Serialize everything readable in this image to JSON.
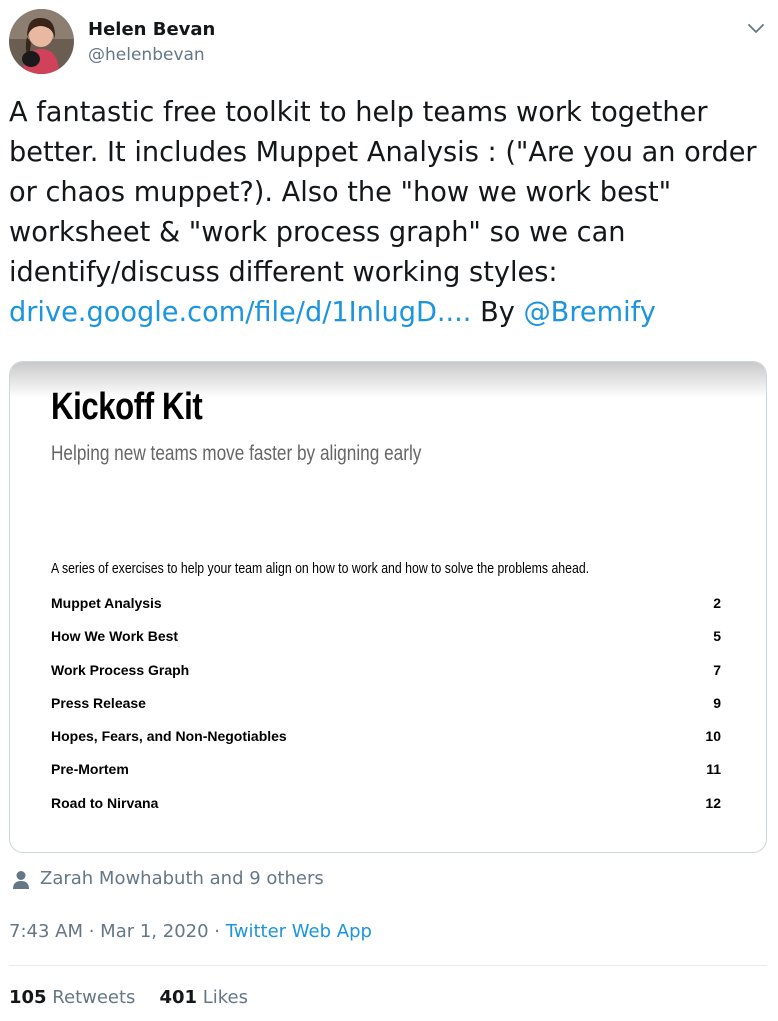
{
  "author": {
    "name": "Helen Bevan",
    "handle": "@helenbevan"
  },
  "tweet": {
    "lines": [
      "A fantastic free toolkit to help teams work together",
      "better. It includes Muppet Analysis : (\"Are you an order",
      "or chaos muppet?). Also the \"how we work best\"",
      "worksheet & \"work process graph\" so we can",
      "identify/discuss different working styles:"
    ],
    "link_text": "drive.google.com/file/d/1InlugD....",
    "by_text": " By ",
    "mention": "@Bremify"
  },
  "media": {
    "title": "Kickoff Kit",
    "subtitle": "Helping new teams move faster by aligning early",
    "intro": "A series of exercises to help your team align on how to work and how to solve the problems ahead.",
    "toc": [
      {
        "label": "Muppet Analysis",
        "page": "2"
      },
      {
        "label": "How We Work Best",
        "page": "5"
      },
      {
        "label": "Work Process Graph",
        "page": "7"
      },
      {
        "label": "Press Release",
        "page": "9"
      },
      {
        "label": "Hopes, Fears, and Non-Negotiables",
        "page": "10"
      },
      {
        "label": "Pre-Mortem",
        "page": "11"
      },
      {
        "label": "Road to Nirvana",
        "page": "12"
      }
    ]
  },
  "likers": {
    "text": "Zarah Mowhabuth and 9 others",
    "icon": "person-icon"
  },
  "meta": {
    "time": "7:43 AM",
    "sep1": " · ",
    "date": "Mar 1, 2020",
    "sep2": " · ",
    "source": "Twitter Web App"
  },
  "stats": {
    "retweets_count": "105",
    "retweets_label": " Retweets",
    "likes_count": "401",
    "likes_label": " Likes"
  },
  "icons": {
    "caret": "chevron-down-icon",
    "avatar": "avatar"
  },
  "colors": {
    "link": "#1b95e0",
    "secondary_text": "#657786",
    "primary_text": "#14171a",
    "border": "#ccd6dd"
  }
}
